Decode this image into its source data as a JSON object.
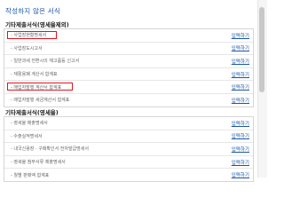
{
  "page_title": "작성하지 않은 서식",
  "sections": [
    {
      "title": "기타제출서식(영세율제외)",
      "rows": [
        {
          "label": "- 사업장현황명세서",
          "action": "입력하기",
          "highlighted": true
        },
        {
          "label": "- 사업장도시고서",
          "action": "입력하기",
          "highlighted": false
        },
        {
          "label": "- 일반과세 전환시의 재고품등 신고서",
          "action": "입력하기",
          "highlighted": false
        },
        {
          "label": "- 재활용폐 계산서 합계표",
          "action": "입력하기",
          "highlighted": false
        },
        {
          "label": "- 매입자발행 계산서 합계표",
          "action": "입력하기",
          "highlighted": true
        },
        {
          "label": "- 매입자발행 세금계산서 합계표",
          "action": "입력하기",
          "highlighted": false
        }
      ]
    },
    {
      "title": "기타제출서식(영세율)",
      "rows": [
        {
          "label": "- 영세율 매출명세서",
          "action": "입력하기",
          "highlighted": false
        },
        {
          "label": "- 수출실적명세서",
          "action": "입력하기",
          "highlighted": false
        },
        {
          "label": "- 내국신용장 · 구매확인서 전자발급명세서",
          "action": "입력하기",
          "highlighted": false
        },
        {
          "label": "- 영세율 첨부서류 제출명세서",
          "action": "입력하기",
          "highlighted": false
        },
        {
          "label": "- 월별 판매액 합계표",
          "action": "입력하기",
          "highlighted": false
        }
      ]
    }
  ],
  "colors": {
    "link": "#1a56a6",
    "highlight": "#e0141e"
  }
}
